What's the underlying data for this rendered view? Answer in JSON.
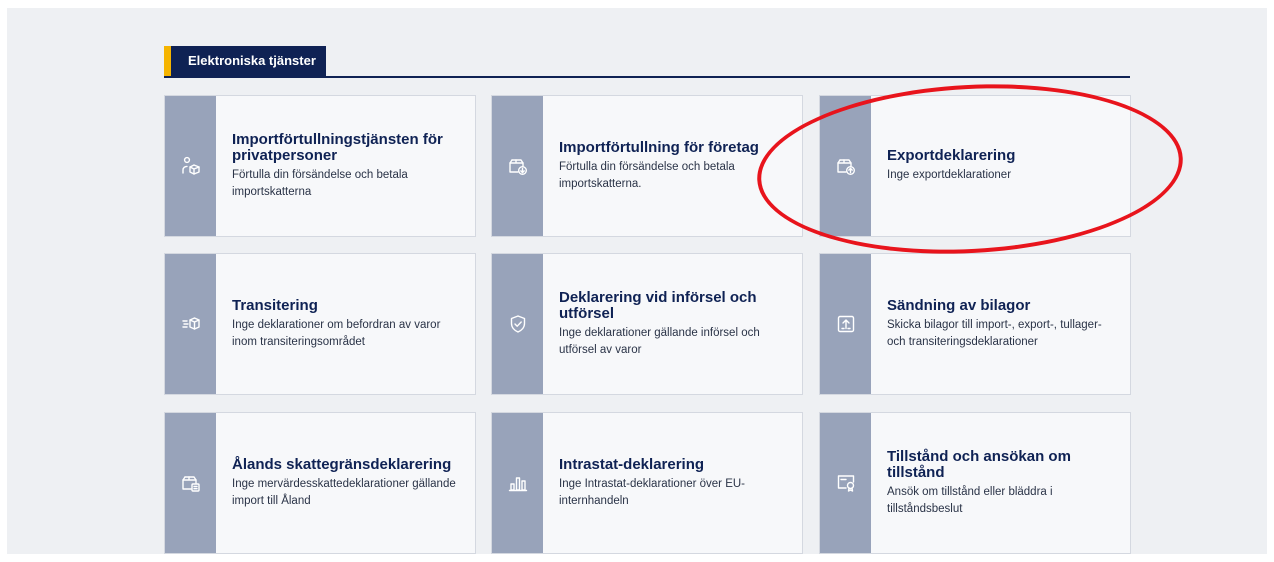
{
  "section": {
    "title": "Elektroniska tjänster"
  },
  "colors": {
    "navy": "#0f2254",
    "accent_yellow": "#f5b400",
    "card_strip": "#98a3ba",
    "annotation_red": "#e8141c"
  },
  "cards": [
    {
      "title": "Importförtullningstjänsten för privatpersoner",
      "description": "Förtulla din försändelse och betala importskatterna",
      "icon": "person-package-icon"
    },
    {
      "title": "Importförtullning för företag",
      "description": "Förtulla din försändelse och betala importskatterna.",
      "icon": "package-download-icon"
    },
    {
      "title": "Exportdeklarering",
      "description": "Inge exportdeklarationer",
      "icon": "package-upload-icon"
    },
    {
      "title": "Transitering",
      "description": "Inge deklarationer om befordran av varor inom transiteringsområdet",
      "icon": "moving-box-icon"
    },
    {
      "title": "Deklarering vid införsel och utförsel",
      "description": "Inge deklarationer gällande införsel och utförsel av varor",
      "icon": "shield-check-icon"
    },
    {
      "title": "Sändning av bilagor",
      "description": "Skicka bilagor till import-, export-, tullager- och transiteringsdeklarationer",
      "icon": "upload-box-icon"
    },
    {
      "title": "Ålands skattegränsdeklarering",
      "description": "Inge mervärdesskattedeklarationer gällande import till Åland",
      "icon": "package-document-icon"
    },
    {
      "title": "Intrastat-deklarering",
      "description": "Inge Intrastat-deklarationer över EU-internhandeln",
      "icon": "bar-chart-icon"
    },
    {
      "title": "Tillstånd och ansökan om tillstånd",
      "description": "Ansök om tillstånd eller bläddra i tillståndsbeslut",
      "icon": "certificate-icon"
    }
  ]
}
